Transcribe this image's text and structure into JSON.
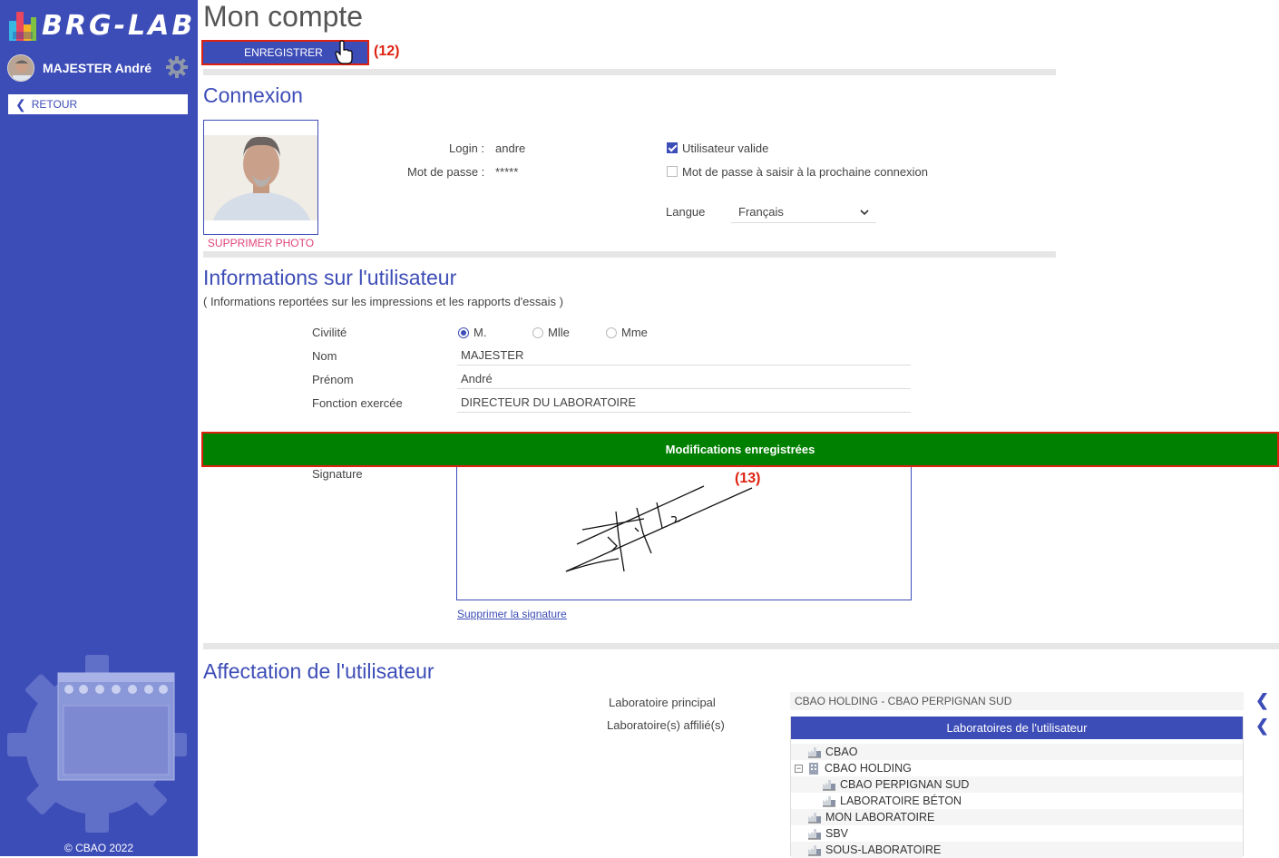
{
  "app": {
    "logo_text": "BRG-LAB",
    "copyright": "© CBAO 2022"
  },
  "user": {
    "name": "MAJESTER André"
  },
  "sidebar": {
    "back_label": "RETOUR"
  },
  "page": {
    "title": "Mon compte",
    "save_label": "ENREGISTRER"
  },
  "annotations": {
    "a12": "(12)",
    "a13": "(13)"
  },
  "connexion": {
    "title": "Connexion",
    "delete_photo": "SUPPRIMER PHOTO",
    "login_label": "Login :",
    "login_value": "andre",
    "password_label": "Mot de passe :",
    "password_value": "*****",
    "valid_user_label": "Utilisateur valide",
    "valid_user_checked": true,
    "change_pwd_label": "Mot de passe à saisir à la prochaine connexion",
    "change_pwd_checked": false,
    "language_label": "Langue",
    "language_value": "Français"
  },
  "info": {
    "title": "Informations sur l'utilisateur",
    "subtitle": "( Informations reportées sur les impressions et les rapports d'essais )",
    "civility_label": "Civilité",
    "civility_options": [
      "M.",
      "Mlle",
      "Mme"
    ],
    "civility_selected": "M.",
    "nom_label": "Nom",
    "nom_value": "MAJESTER",
    "prenom_label": "Prénom",
    "prenom_value": "André",
    "fonction_label": "Fonction exercée",
    "fonction_value": "DIRECTEUR DU LABORATOIRE",
    "signature_label": "Signature",
    "delete_signature": "Supprimer la signature"
  },
  "banner": {
    "message": "Modifications enregistrées",
    "color": "#008000"
  },
  "affectation": {
    "title": "Affectation de l'utilisateur",
    "main_lab_label": "Laboratoire principal",
    "main_lab_value": "CBAO HOLDING - CBAO PERPIGNAN SUD",
    "affiliated_label": "Laboratoire(s) affilié(s)",
    "tree_header": "Laboratoires de l'utilisateur",
    "tree": [
      "CBAO",
      "CBAO HOLDING",
      "CBAO PERPIGNAN SUD",
      "LABORATOIRE BÉTON",
      "MON LABORATOIRE",
      "SBV",
      "SOUS-LABORATOIRE"
    ]
  },
  "colors": {
    "accent": "#3d4db7",
    "alert_border": "#dd2211",
    "delete_link": "#e0457b"
  }
}
